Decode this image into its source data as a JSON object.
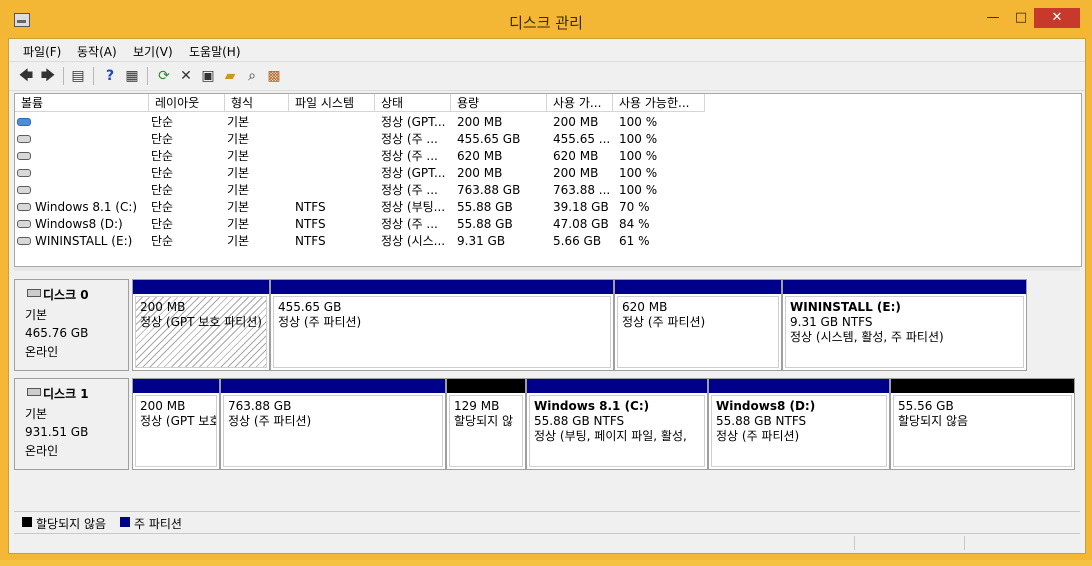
{
  "window": {
    "title": "디스크 관리",
    "min": "—",
    "max": "□",
    "close": "✕"
  },
  "menu": [
    "파일(F)",
    "동작(A)",
    "보기(V)",
    "도움말(H)"
  ],
  "toolbar": {
    "back": "back-icon",
    "forward": "forward-icon",
    "console": "console-tree-icon",
    "help": "help-icon",
    "properties_pane": "properties-pane-icon",
    "refresh": "refresh-icon",
    "delete": "delete-icon",
    "properties": "properties-icon",
    "open": "open-icon",
    "explore": "explore-icon",
    "help2": "help-topics-icon"
  },
  "columns": [
    "볼륨",
    "레이아웃",
    "형식",
    "파일 시스템",
    "상태",
    "용량",
    "사용 가...",
    "사용 가능한..."
  ],
  "volumes": [
    {
      "name": "",
      "icon": "blue",
      "layout": "단순",
      "type": "기본",
      "fs": "",
      "status": "정상 (GPT...",
      "capacity": "200 MB",
      "free": "200 MB",
      "pct": "100 %"
    },
    {
      "name": "",
      "icon": "gray",
      "layout": "단순",
      "type": "기본",
      "fs": "",
      "status": "정상 (주 ...",
      "capacity": "455.65 GB",
      "free": "455.65 ...",
      "pct": "100 %"
    },
    {
      "name": "",
      "icon": "gray",
      "layout": "단순",
      "type": "기본",
      "fs": "",
      "status": "정상 (주 ...",
      "capacity": "620 MB",
      "free": "620 MB",
      "pct": "100 %"
    },
    {
      "name": "",
      "icon": "gray",
      "layout": "단순",
      "type": "기본",
      "fs": "",
      "status": "정상 (GPT...",
      "capacity": "200 MB",
      "free": "200 MB",
      "pct": "100 %"
    },
    {
      "name": "",
      "icon": "gray",
      "layout": "단순",
      "type": "기본",
      "fs": "",
      "status": "정상 (주 ...",
      "capacity": "763.88 GB",
      "free": "763.88 ...",
      "pct": "100 %"
    },
    {
      "name": "Windows 8.1 (C:)",
      "icon": "gray",
      "layout": "단순",
      "type": "기본",
      "fs": "NTFS",
      "status": "정상 (부팅...",
      "capacity": "55.88 GB",
      "free": "39.18 GB",
      "pct": "70 %"
    },
    {
      "name": "Windows8 (D:)",
      "icon": "gray",
      "layout": "단순",
      "type": "기본",
      "fs": "NTFS",
      "status": "정상 (주 ...",
      "capacity": "55.88 GB",
      "free": "47.08 GB",
      "pct": "84 %"
    },
    {
      "name": "WININSTALL (E:)",
      "icon": "gray",
      "layout": "단순",
      "type": "기본",
      "fs": "NTFS",
      "status": "정상 (시스...",
      "capacity": "9.31 GB",
      "free": "5.66 GB",
      "pct": "61 %"
    }
  ],
  "disks": [
    {
      "name": "디스크 0",
      "type": "기본",
      "size": "465.76 GB",
      "state": "온라인",
      "partitions": [
        {
          "label": "",
          "size": "200 MB",
          "status": "정상 (GPT 보호 파티션)",
          "bar": "primary",
          "hatched": true
        },
        {
          "label": "",
          "size": "455.65 GB",
          "status": "정상 (주 파티션)",
          "bar": "primary",
          "hatched": false
        },
        {
          "label": "",
          "size": "620 MB",
          "status": "정상 (주 파티션)",
          "bar": "primary",
          "hatched": false
        },
        {
          "label": "WININSTALL  (E:)",
          "size": "9.31 GB NTFS",
          "status": "정상 (시스템, 활성, 주 파티션)",
          "bar": "primary",
          "hatched": false
        }
      ]
    },
    {
      "name": "디스크 1",
      "type": "기본",
      "size": "931.51 GB",
      "state": "온라인",
      "partitions": [
        {
          "label": "",
          "size": "200 MB",
          "status": "정상 (GPT 보호",
          "bar": "primary",
          "hatched": false
        },
        {
          "label": "",
          "size": "763.88 GB",
          "status": "정상 (주 파티션)",
          "bar": "primary",
          "hatched": false
        },
        {
          "label": "",
          "size": "129 MB",
          "status": "할당되지 않",
          "bar": "unallocated",
          "hatched": false
        },
        {
          "label": "Windows 8.1  (C:)",
          "size": "55.88 GB NTFS",
          "status": "정상 (부팅, 페이지 파일, 활성,",
          "bar": "primary",
          "hatched": false
        },
        {
          "label": "Windows8  (D:)",
          "size": "55.88 GB NTFS",
          "status": "정상 (주 파티션)",
          "bar": "primary",
          "hatched": false
        },
        {
          "label": "",
          "size": "55.56 GB",
          "status": "할당되지 않음",
          "bar": "unallocated",
          "hatched": false
        }
      ]
    }
  ],
  "legend": [
    {
      "label": "할당되지 않음",
      "color": "#000000"
    },
    {
      "label": "주 파티션",
      "color": "#00008b"
    }
  ],
  "colors": {
    "primary": "#00008b",
    "unallocated": "#000000",
    "title_bg": "#f3b735",
    "close_bg": "#c73a2b"
  }
}
